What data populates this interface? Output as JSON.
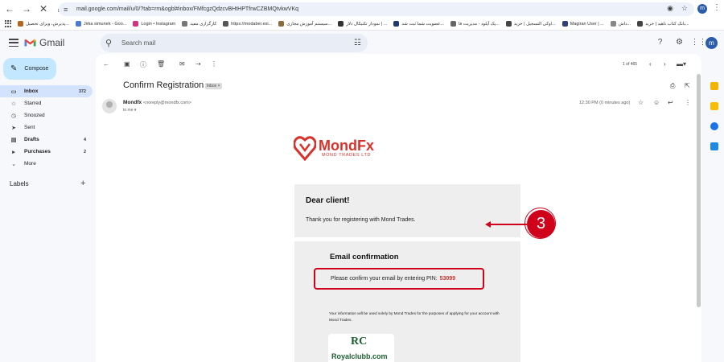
{
  "browser": {
    "url": "mail.google.com/mail/u/0/?tab=rm&ogbl#inbox/FMfcgzQdzcvBHtHPTfrwCZBMQtvkwVKq",
    "profile_initial": "m",
    "bookmarks": [
      "بانک کتاب ناهید | خرید...",
      "داش...",
      "Magiran User | ...",
      "اوکی التسجیل | خرید...",
      "پک آپلود - مدیریت فا...",
      "عضویت شما ثبت شد...",
      "نمودار تکنیکال دلار | ...",
      "سیستم آموزش مجازی...",
      "https://modaber.esi...",
      "کارگزاری مفید",
      "Login • Instagram",
      "Jirka simunek - Goo...",
      "پذیرش، ویزای تحصیل..."
    ]
  },
  "gmail": {
    "brand": "Gmail",
    "search_placeholder": "Search mail",
    "compose_label": "Compose",
    "avatar_initial": "m",
    "nav": [
      {
        "icon": "inbox-icon",
        "label": "Inbox",
        "count": "372",
        "active": true
      },
      {
        "icon": "star-icon",
        "label": "Starred",
        "count": ""
      },
      {
        "icon": "clock-icon",
        "label": "Snoozed",
        "count": ""
      },
      {
        "icon": "send-icon",
        "label": "Sent",
        "count": ""
      },
      {
        "icon": "draft-icon",
        "label": "Drafts",
        "count": "4"
      },
      {
        "icon": "label-icon",
        "label": "Purchases",
        "count": "2"
      },
      {
        "icon": "chevron-down-icon",
        "label": "More",
        "count": ""
      }
    ],
    "labels_header": "Labels",
    "pager": "1 of 465"
  },
  "email": {
    "subject": "Confirm Registration",
    "tag": "Inbox ×",
    "sender_name": "Mondfx",
    "sender_addr": "<noreply@mondfx.com>",
    "to": "to me ▾",
    "time": "12:30 PM (0 minutes ago)",
    "brand_name": "MondFx",
    "brand_sub": "MOND TRADES LTD",
    "greeting": "Dear client!",
    "thanks": "Thank you for registering with Mond Trades.",
    "confirm_title": "Email confirmation",
    "pin_text": "Please confirm your email by entering PIN:",
    "pin": "53099",
    "info_text": "Your information will be used solely by Mond Trades for the purposes of applying for your account with Mond Trades.",
    "partner_mark": "RC",
    "partner_name": "Royalclubb.com"
  },
  "annotation": {
    "step_number": "3",
    "color": "#d0021b"
  }
}
